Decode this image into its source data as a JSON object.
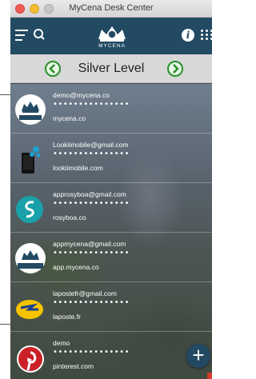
{
  "window": {
    "title": "MyCena Desk Center"
  },
  "header": {
    "logo_text": "MYCENA"
  },
  "level": {
    "title": "Silver Level"
  },
  "accounts": [
    {
      "email": "demo@mycena.co",
      "password": "•••••••••••••••",
      "site": "mycena.co",
      "icon": "mycena-logo-icon"
    },
    {
      "email": "Lookiimobile@gmail.com",
      "password": "•••••••••••••••",
      "site": "lookiimobile.com",
      "icon": "lookii-mobile-icon"
    },
    {
      "email": "approsyboa@gmail.com",
      "password": "•••••••••••••••",
      "site": "rosyboa.co",
      "icon": "rosyboa-icon"
    },
    {
      "email": "appmycena@gmail.com",
      "password": "•••••••••••••••",
      "site": "app.mycena.co",
      "icon": "mycena-app-icon"
    },
    {
      "email": "lapostefr@gmail.com",
      "password": "•••••••••••••••",
      "site": "laposte.fr",
      "icon": "laposte-icon"
    },
    {
      "email": "demo",
      "password": "•••••••••••••••",
      "site": "pinterest.com",
      "icon": "pinterest-icon"
    }
  ],
  "colors": {
    "header": "#234a63",
    "level_arrow": "#2a8f2a",
    "pinterest": "#cb2027",
    "rosyboa": "#1aa0a8",
    "laposte": "#f5c400"
  }
}
